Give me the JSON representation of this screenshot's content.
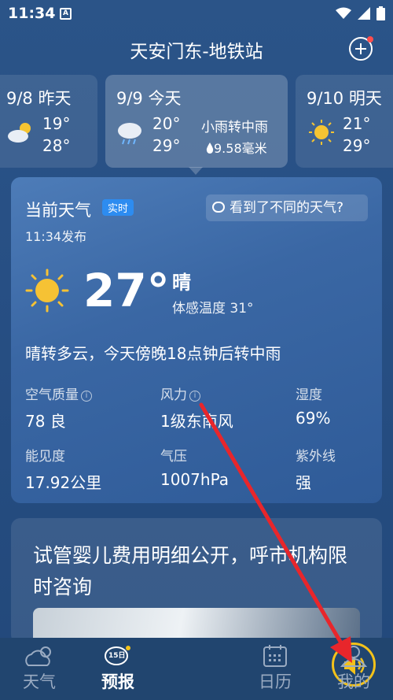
{
  "status_bar": {
    "time": "11:34",
    "app_icon_letter": "A"
  },
  "header": {
    "location": "天安门东-地铁站"
  },
  "days": [
    {
      "date": "9/8 昨天",
      "high": "19°",
      "low": "28°",
      "icon": "partly-cloudy-icon"
    },
    {
      "date": "9/9 今天",
      "high": "20°",
      "low": "29°",
      "desc": "小雨转中雨",
      "rain": "9.58毫米",
      "icon": "rain-cloud-icon"
    },
    {
      "date": "9/10 明天",
      "high": "21°",
      "low": "29°",
      "icon": "sun-icon"
    }
  ],
  "current": {
    "title": "当前天气",
    "badge": "实时",
    "feedback": "看到了不同的天气?",
    "publish_time": "11:34发布",
    "temperature": "27°",
    "condition": "晴",
    "feels_like": "体感温度 31°",
    "forecast": "晴转多云，今天傍晚18点钟后转中雨",
    "metrics": [
      {
        "label": "空气质量",
        "value": "78 良",
        "info": true
      },
      {
        "label": "风力",
        "value": "1级东南风",
        "info": true
      },
      {
        "label": "湿度",
        "value": "69%"
      },
      {
        "label": "能见度",
        "value": "17.92公里"
      },
      {
        "label": "气压",
        "value": "1007hPa"
      },
      {
        "label": "紫外线",
        "value": "强"
      }
    ]
  },
  "news": {
    "title": "试管婴儿费用明细公开，呼市机构限时咨询"
  },
  "nav": [
    {
      "label": "天气",
      "icon": "weather-cloud-icon"
    },
    {
      "label": "预报",
      "icon": "calendar-15-day-icon",
      "badge": "15日"
    },
    {
      "label": "",
      "icon": "speaker-icon"
    },
    {
      "label": "日历",
      "icon": "calendar-icon"
    },
    {
      "label": "我的",
      "icon": "profile-icon"
    }
  ],
  "colors": {
    "accent": "#f3c21a",
    "badge": "#2d8cf0",
    "arrow": "#e8262b"
  }
}
